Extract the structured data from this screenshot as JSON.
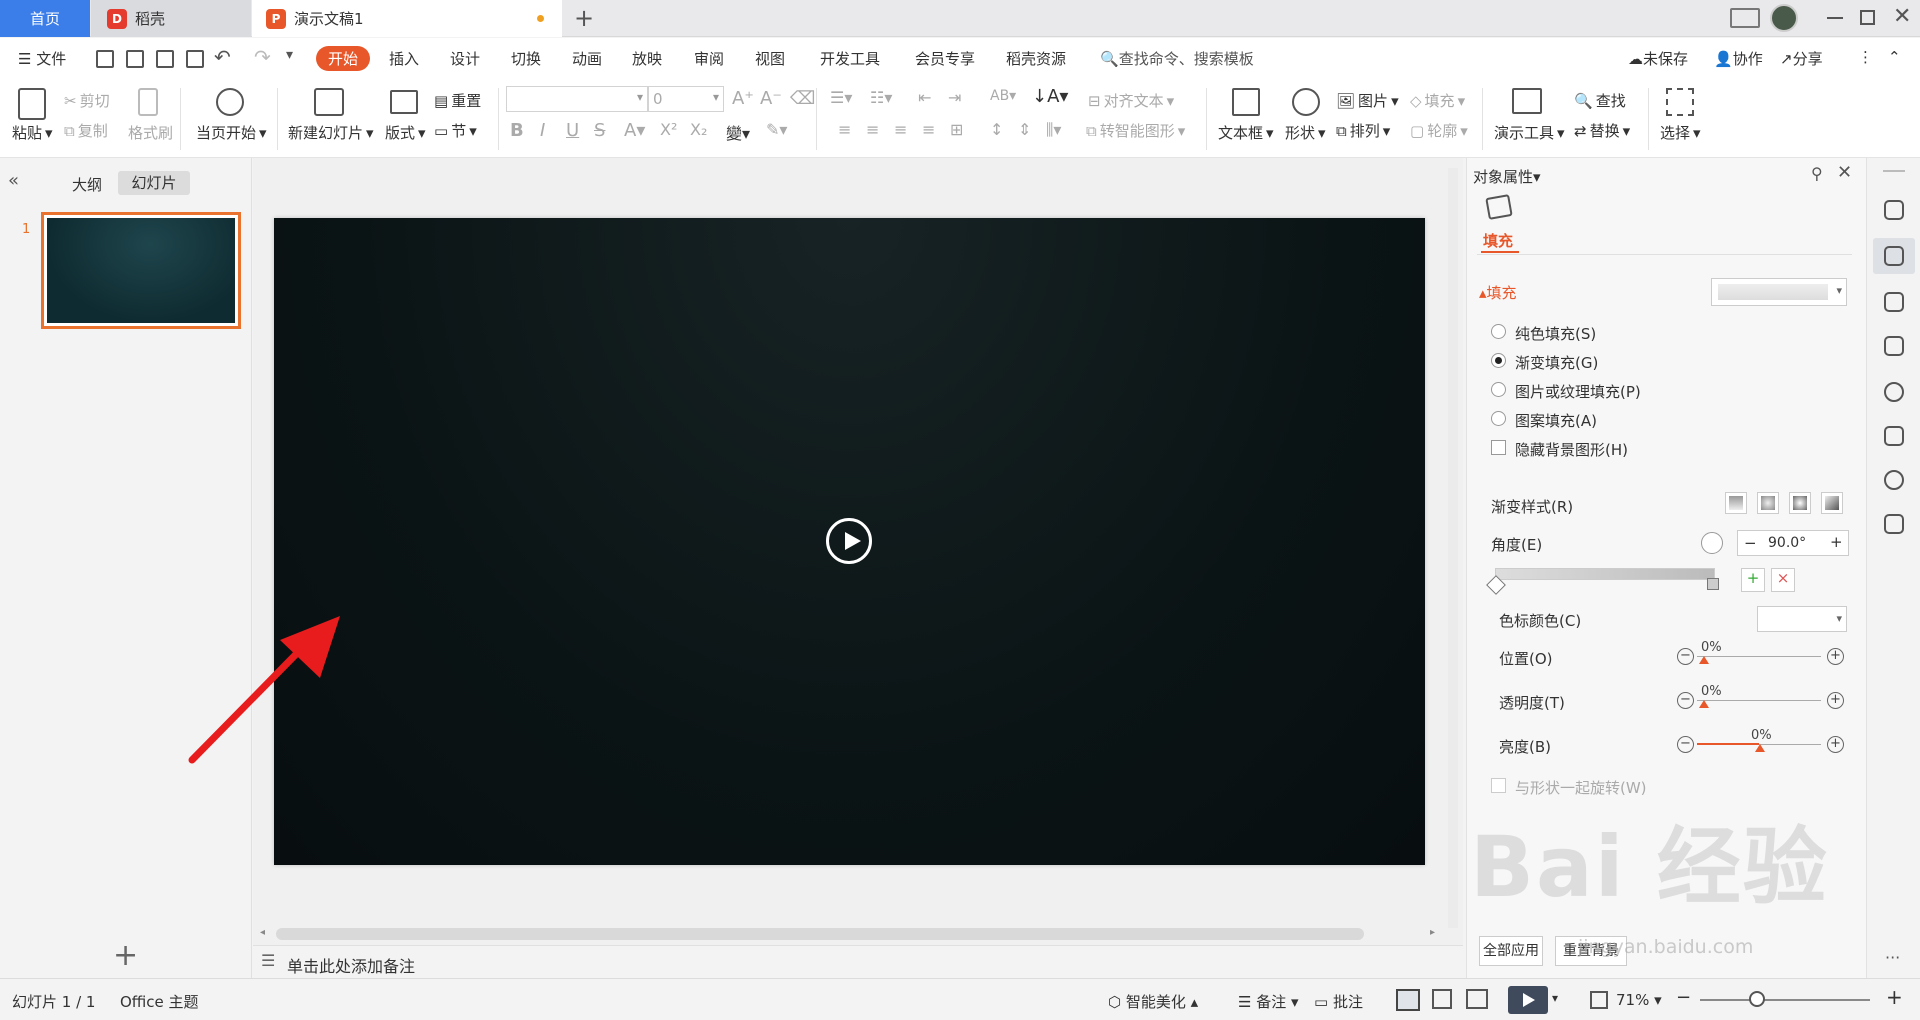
{
  "tabs": {
    "home": "首页",
    "daoke": "稻壳",
    "doc": "演示文稿1",
    "add": "+"
  },
  "menu": {
    "file": "文件",
    "start": "开始",
    "insert": "插入",
    "design": "设计",
    "switch": "切换",
    "animation": "动画",
    "slideshow": "放映",
    "review": "审阅",
    "view": "视图",
    "devtools": "开发工具",
    "member": "会员专享",
    "daoke_res": "稻壳资源",
    "search": "查找命令、搜索模板",
    "unsaved": "未保存",
    "collab": "协作",
    "share": "分享"
  },
  "ribbon": {
    "paste": "粘贴",
    "cut": "剪切",
    "copy": "复制",
    "format_painter": "格式刷",
    "from_current": "当页开始",
    "new_slide": "新建幻灯片",
    "layout": "版式",
    "reset": "重置",
    "section": "节",
    "font_size": "0",
    "align_text": "对齐文本",
    "smart_shape": "转智能图形",
    "textbox": "文本框",
    "shape": "形状",
    "picture": "图片",
    "arrange": "排列",
    "fill": "填充",
    "outline": "轮廓",
    "present_tools": "演示工具",
    "find": "查找",
    "replace": "替换",
    "select": "选择"
  },
  "leftpanel": {
    "outline": "大纲",
    "slides": "幻灯片",
    "slide_num": "1",
    "add": "+"
  },
  "notes": "单击此处添加备注",
  "props": {
    "title": "对象属性",
    "tab_fill": "填充",
    "section_fill": "填充",
    "solid": "纯色填充(S)",
    "gradient": "渐变填充(G)",
    "picture_tex": "图片或纹理填充(P)",
    "pattern": "图案填充(A)",
    "hide_bg": "隐藏背景图形(H)",
    "grad_style": "渐变样式(R)",
    "angle": "角度(E)",
    "angle_val": "90.0°",
    "stop_color": "色标颜色(C)",
    "position": "位置(O)",
    "position_val": "0%",
    "transparency": "透明度(T)",
    "transparency_val": "0%",
    "brightness": "亮度(B)",
    "brightness_val": "0%",
    "rotate": "与形状一起旋转(W)",
    "apply_all": "全部应用",
    "reset_bg": "重置背景",
    "minus": "−",
    "plus": "+",
    "o_minus": "−",
    "o_plus": "+"
  },
  "watermark": {
    "brand": "Bai  经验",
    "url": "jingyan.baidu.com"
  },
  "status": {
    "slide": "幻灯片 1 / 1",
    "theme": "Office 主题",
    "beautify": "智能美化",
    "notes": "备注",
    "comment": "批注",
    "zoom": "71%"
  },
  "colors": {
    "accent": "#e8572a",
    "home_tab": "#3b7de9",
    "slide_bg": "#0b1415",
    "thumb_border": "#e8722e",
    "arrow": "#e81c1c"
  }
}
